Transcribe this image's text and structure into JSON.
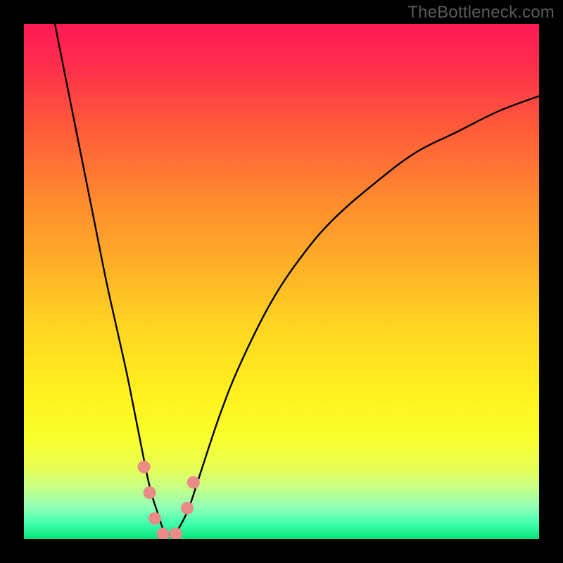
{
  "watermark": {
    "text": "TheBottleneck.com"
  },
  "chart_data": {
    "type": "line",
    "title": "",
    "xlabel": "",
    "ylabel": "",
    "xlim": [
      0,
      100
    ],
    "ylim": [
      0,
      100
    ],
    "grid": false,
    "legend": false,
    "annotations": [],
    "series": [
      {
        "name": "bottleneck-curve",
        "color": "#000000",
        "x": [
          6,
          8,
          10,
          12,
          14,
          16,
          18,
          20,
          22,
          24,
          25,
          26,
          27,
          28,
          29,
          30,
          32,
          34,
          38,
          42,
          48,
          54,
          60,
          68,
          76,
          84,
          92,
          100
        ],
        "y": [
          100,
          90,
          80,
          70,
          60,
          50,
          41,
          32,
          22,
          12,
          8,
          5,
          2,
          1,
          1,
          2,
          6,
          12,
          24,
          34,
          46,
          55,
          62,
          69,
          75,
          79,
          83,
          86
        ]
      }
    ],
    "markers": [
      {
        "name": "curve-dots",
        "color": "#e98b87",
        "radius_px": 9,
        "points": [
          {
            "x": 23.3,
            "y": 14
          },
          {
            "x": 24.4,
            "y": 9
          },
          {
            "x": 25.4,
            "y": 4
          },
          {
            "x": 27.0,
            "y": 1
          },
          {
            "x": 29.5,
            "y": 1
          },
          {
            "x": 31.7,
            "y": 6
          },
          {
            "x": 32.9,
            "y": 11
          }
        ]
      }
    ],
    "background_gradient": {
      "type": "vertical",
      "stops": [
        {
          "pos": 0.0,
          "color": "#ff1a55"
        },
        {
          "pos": 0.6,
          "color": "#ffd822"
        },
        {
          "pos": 0.8,
          "color": "#faff2b"
        },
        {
          "pos": 1.0,
          "color": "#05e27a"
        }
      ]
    }
  }
}
